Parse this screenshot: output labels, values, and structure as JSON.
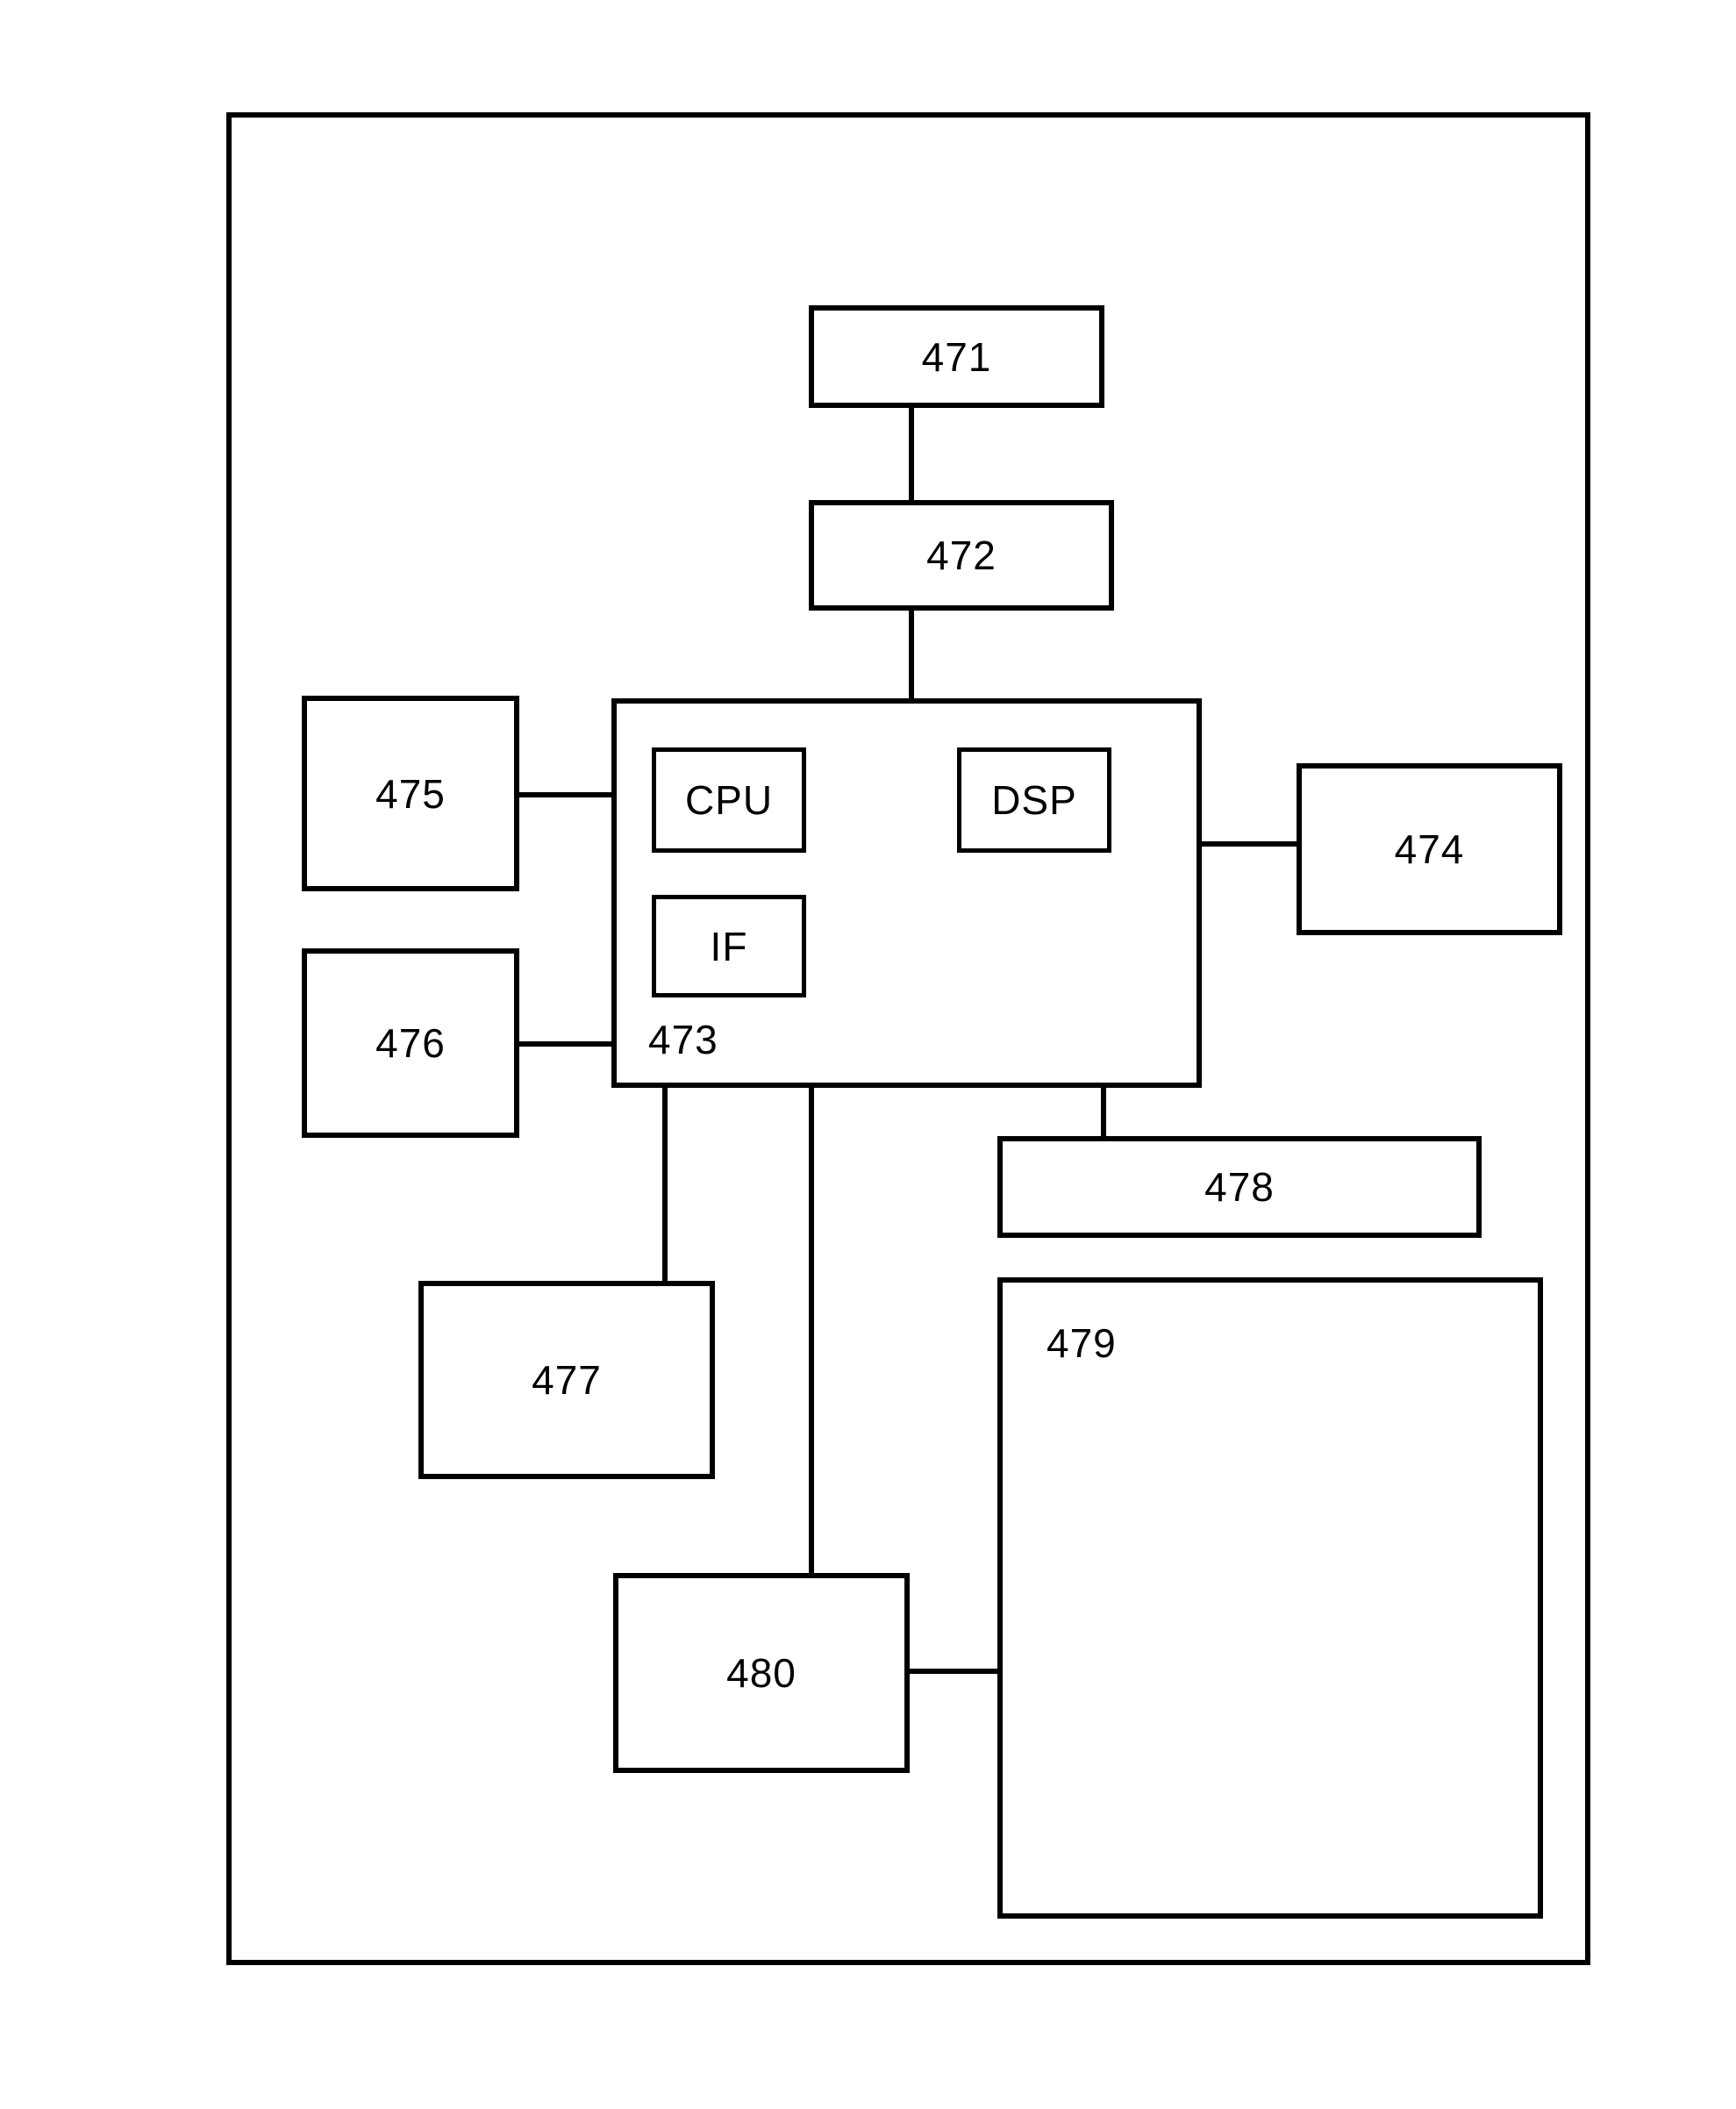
{
  "diagram": {
    "type": "block-diagram",
    "title": "",
    "outer_frame": {
      "label": ""
    },
    "blocks": [
      {
        "id": "b471",
        "label": "471",
        "label_position": "center"
      },
      {
        "id": "b472",
        "label": "472",
        "label_position": "center"
      },
      {
        "id": "b473",
        "label": "473",
        "label_position": "bottom-left"
      },
      {
        "id": "b474",
        "label": "474",
        "label_position": "center"
      },
      {
        "id": "b475",
        "label": "475",
        "label_position": "center"
      },
      {
        "id": "b476",
        "label": "476",
        "label_position": "center"
      },
      {
        "id": "b477",
        "label": "477",
        "label_position": "center"
      },
      {
        "id": "b478",
        "label": "478",
        "label_position": "center"
      },
      {
        "id": "b479",
        "label": "479",
        "label_position": "top-left"
      },
      {
        "id": "b480",
        "label": "480",
        "label_position": "center"
      },
      {
        "id": "cpu",
        "label": "CPU",
        "label_position": "center"
      },
      {
        "id": "dsp",
        "label": "DSP",
        "label_position": "center"
      },
      {
        "id": "if",
        "label": "IF",
        "label_position": "center"
      }
    ],
    "connections": [
      {
        "from": "471",
        "to": "472"
      },
      {
        "from": "472",
        "to": "473"
      },
      {
        "from": "475",
        "to": "473"
      },
      {
        "from": "476",
        "to": "473"
      },
      {
        "from": "473",
        "to": "474"
      },
      {
        "from": "473",
        "to": "477"
      },
      {
        "from": "473",
        "to": "480"
      },
      {
        "from": "473",
        "to": "478"
      },
      {
        "from": "480",
        "to": "479"
      }
    ],
    "colors": {
      "line": "#000000",
      "background": "#ffffff",
      "text": "#000000"
    }
  }
}
